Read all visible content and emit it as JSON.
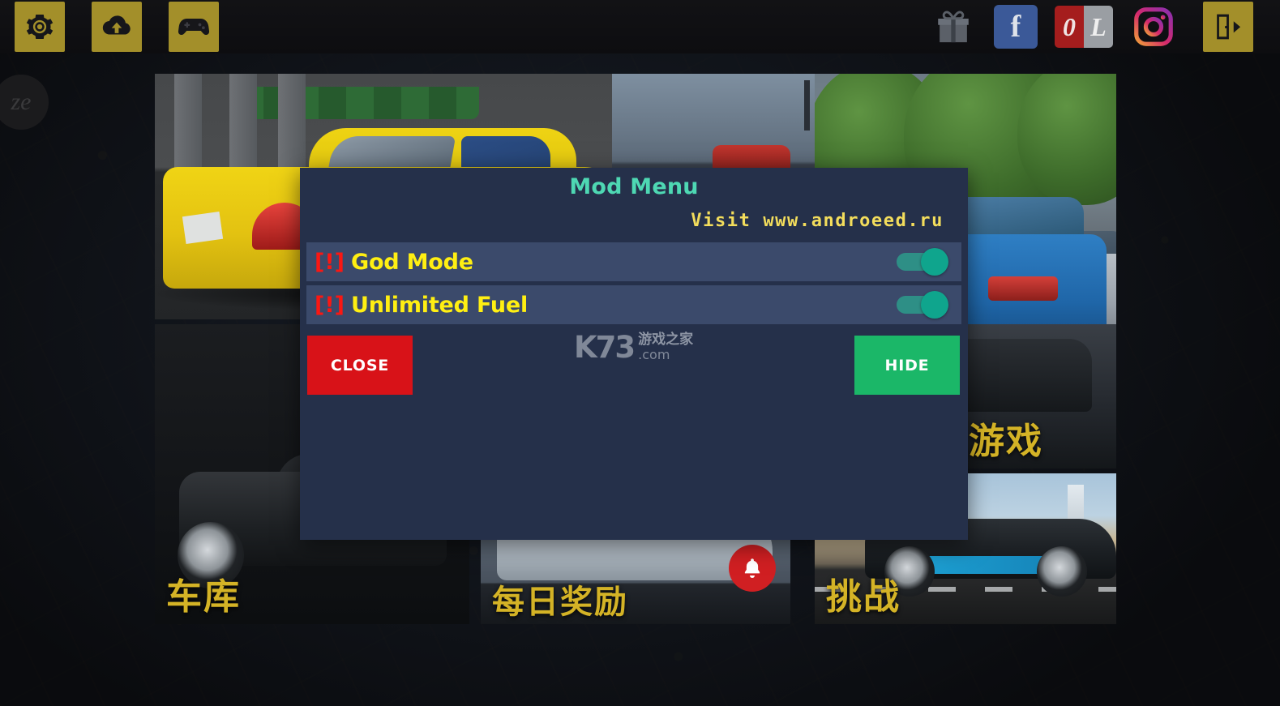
{
  "app": {
    "background_logo": "ze"
  },
  "topbar": {
    "left_buttons": [
      {
        "name": "settings-button",
        "icon": "gear-icon"
      },
      {
        "name": "cloud-upload-button",
        "icon": "cloud-upload-icon"
      },
      {
        "name": "controller-button",
        "icon": "gamepad-icon"
      }
    ],
    "right_buttons": [
      {
        "name": "gift-button",
        "icon": "gift-icon"
      },
      {
        "name": "facebook-button",
        "icon": "facebook-icon",
        "label": "f"
      },
      {
        "name": "ol-button",
        "icon": "ol-logo-icon",
        "label_a": "0",
        "label_b": "L"
      },
      {
        "name": "instagram-button",
        "icon": "instagram-icon"
      },
      {
        "name": "exit-button",
        "icon": "exit-door-icon"
      }
    ]
  },
  "tiles": [
    {
      "name": "tile-taxi",
      "caption": ""
    },
    {
      "name": "tile-trees",
      "caption": ""
    },
    {
      "name": "tile-black-car",
      "caption": "车库"
    },
    {
      "name": "tile-daily",
      "caption": "每日奖励",
      "badge": "bell-icon"
    },
    {
      "name": "tile-games",
      "caption": "游戏"
    },
    {
      "name": "tile-challenge",
      "caption": "挑战"
    }
  ],
  "dialog": {
    "title": "Mod Menu",
    "visit": "Visit www.androeed.ru",
    "options": [
      {
        "prefix": "[!]",
        "label": "God Mode",
        "state": "on"
      },
      {
        "prefix": "[!]",
        "label": "Unlimited Fuel",
        "state": "on"
      }
    ],
    "close_label": "CLOSE",
    "hide_label": "HIDE",
    "colors": {
      "panel": "#25304a",
      "row": "#3b4a6b",
      "title": "#4ed8b3",
      "visit": "#f3dd5c",
      "option_label": "#ffef12",
      "option_prefix": "#fb1712",
      "toggle_on": "#0fa58d",
      "close": "#d81218",
      "hide": "#1bb768"
    }
  },
  "watermark": {
    "brand": "K73",
    "chinese": "游戏之家",
    "domain": ".com"
  }
}
